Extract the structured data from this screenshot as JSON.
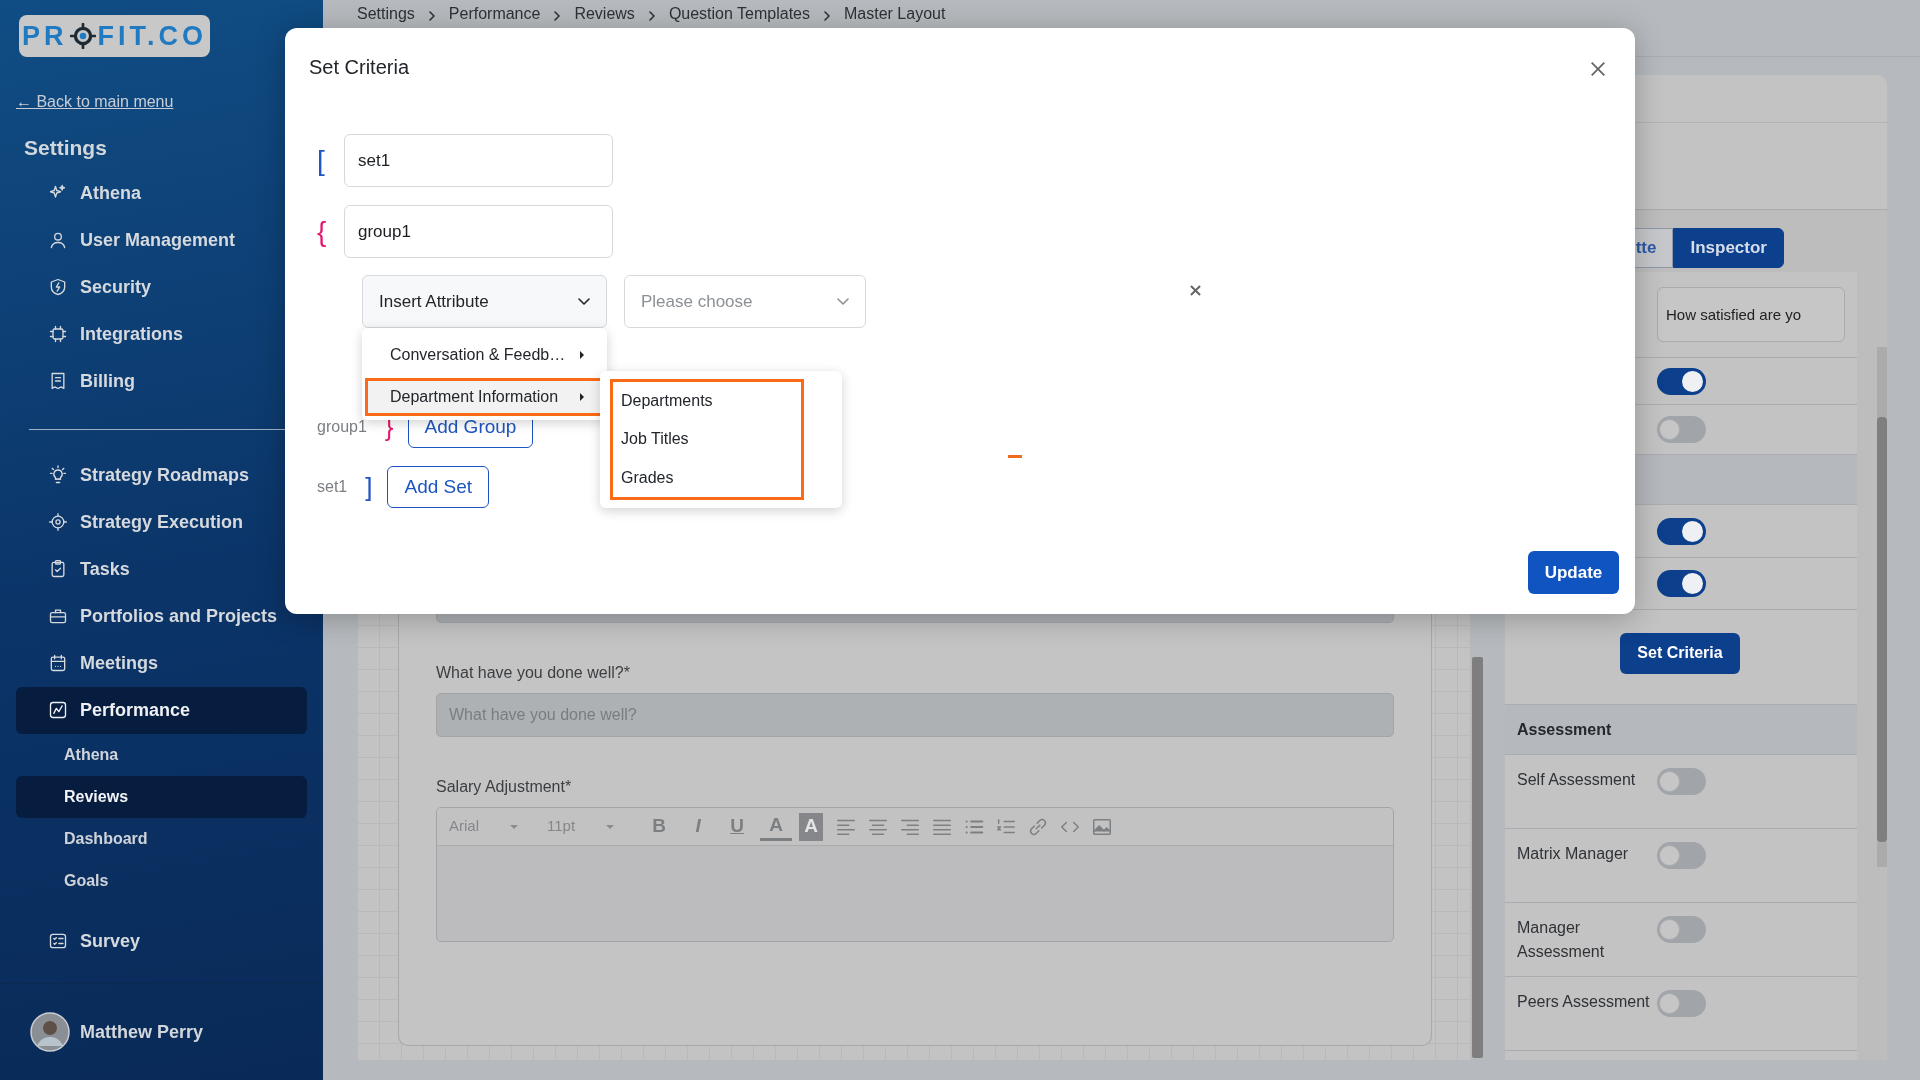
{
  "sidebar": {
    "logo": [
      "PR",
      "FIT.CO"
    ],
    "back_link": "← Back to main menu",
    "heading": "Settings",
    "settings_items": [
      {
        "label": "Athena"
      },
      {
        "label": "User Management"
      },
      {
        "label": "Security"
      },
      {
        "label": "Integrations"
      },
      {
        "label": "Billing"
      }
    ],
    "modules": [
      {
        "label": "Strategy Roadmaps",
        "selected": false
      },
      {
        "label": "Strategy Execution",
        "selected": false
      },
      {
        "label": "Tasks",
        "selected": false
      },
      {
        "label": "Portfolios and Projects",
        "selected": false
      },
      {
        "label": "Meetings",
        "selected": false
      },
      {
        "label": "Performance",
        "selected": true,
        "children": [
          {
            "label": "Athena",
            "selected": false
          },
          {
            "label": "Reviews",
            "selected": true
          },
          {
            "label": "Dashboard",
            "selected": false
          },
          {
            "label": "Goals",
            "selected": false
          }
        ]
      },
      {
        "label": "Survey",
        "selected": false
      }
    ],
    "user": {
      "name": "Matthew Perry"
    }
  },
  "breadcrumb": [
    "Settings",
    "Performance",
    "Reviews",
    "Question Templates",
    "Master Layout"
  ],
  "form": {
    "fields": [
      {
        "kind": "input"
      },
      {
        "kind": "input",
        "label": "What have you done well?*",
        "placeholder": "What have you done well?"
      },
      {
        "kind": "editor",
        "label": "Salary Adjustment*",
        "font": "Arial",
        "size": "11pt",
        "glyphs": [
          "B",
          "I",
          "U",
          "A",
          "A"
        ]
      }
    ]
  },
  "panel": {
    "tabs": [
      {
        "label": "tte",
        "selected": false
      },
      {
        "label": "Inspector",
        "selected": true
      }
    ],
    "question_text": "How satisfied are yo",
    "toggles": [
      {
        "on": true
      },
      {
        "on": false
      }
    ],
    "toggles_2": [
      {
        "on": true
      },
      {
        "on": true
      }
    ],
    "set_criteria_button": "Set Criteria",
    "assessment": {
      "title": "Assessment",
      "rows": [
        {
          "label": "Self Assessment",
          "on": false
        },
        {
          "label": "Matrix Manager",
          "on": false
        },
        {
          "label": "Manager Assessment",
          "on": false
        },
        {
          "label": "Peers Assessment",
          "on": false
        }
      ]
    }
  },
  "modal": {
    "title": "Set Criteria",
    "set_open": "[",
    "set_name": "set1",
    "group_open": "{",
    "group_name": "group1",
    "attribute_select": "Insert Attribute",
    "value_placeholder": "Please choose",
    "menu": [
      {
        "label": "Conversation & Feedb…",
        "selected": false
      },
      {
        "label": "Department Information",
        "selected": true
      }
    ],
    "submenu": [
      "Departments",
      "Job Titles",
      "Grades"
    ],
    "group_footer": {
      "label": "group1",
      "close": "}",
      "button": "Add Group"
    },
    "set_footer": {
      "label": "set1",
      "close": "]",
      "button": "Add Set"
    },
    "update_button": "Update"
  }
}
